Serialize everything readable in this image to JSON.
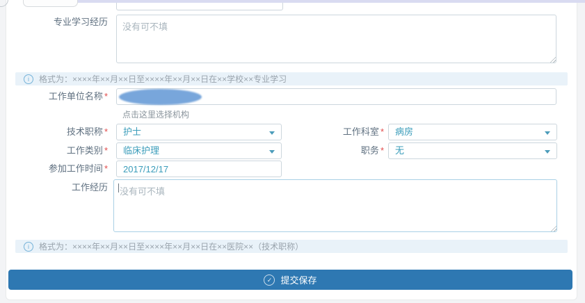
{
  "ui": {
    "required_mark": "*",
    "info_icon_glyph": "i",
    "check_icon_glyph": "✓"
  },
  "colors": {
    "accent_blue": "#2e78b2",
    "value_teal": "#3a9cba",
    "required_red": "#e24c4c",
    "note_bg": "#e9f2f9",
    "note_text": "#9aa4ad",
    "redaction_blob": "#78a6db",
    "top_strip": "#d9dbf1"
  },
  "form": {
    "study_experience": {
      "label": "专业学习经历",
      "placeholder": "没有可不填",
      "value": ""
    },
    "note_study": "格式为：××××年××月××日至××××年××月××日在××学校××专业学习",
    "work_unit": {
      "label": "工作单位名称",
      "value": "",
      "select_link": "点击这里选择机构"
    },
    "tech_title": {
      "label": "技术职称",
      "value": "护士"
    },
    "work_dept": {
      "label": "工作科室",
      "value": "病房"
    },
    "work_category": {
      "label": "工作类别",
      "value": "临床护理"
    },
    "position": {
      "label": "职务",
      "value": "无"
    },
    "work_start_date": {
      "label": "参加工作时间",
      "value": "2017/12/17"
    },
    "work_experience": {
      "label": "工作经历",
      "placeholder": "没有可不填",
      "value": ""
    },
    "note_work": "格式为：××××年××月××日至××××年××月××日在××医院××（技术职称）",
    "submit": {
      "label": "提交保存"
    }
  }
}
